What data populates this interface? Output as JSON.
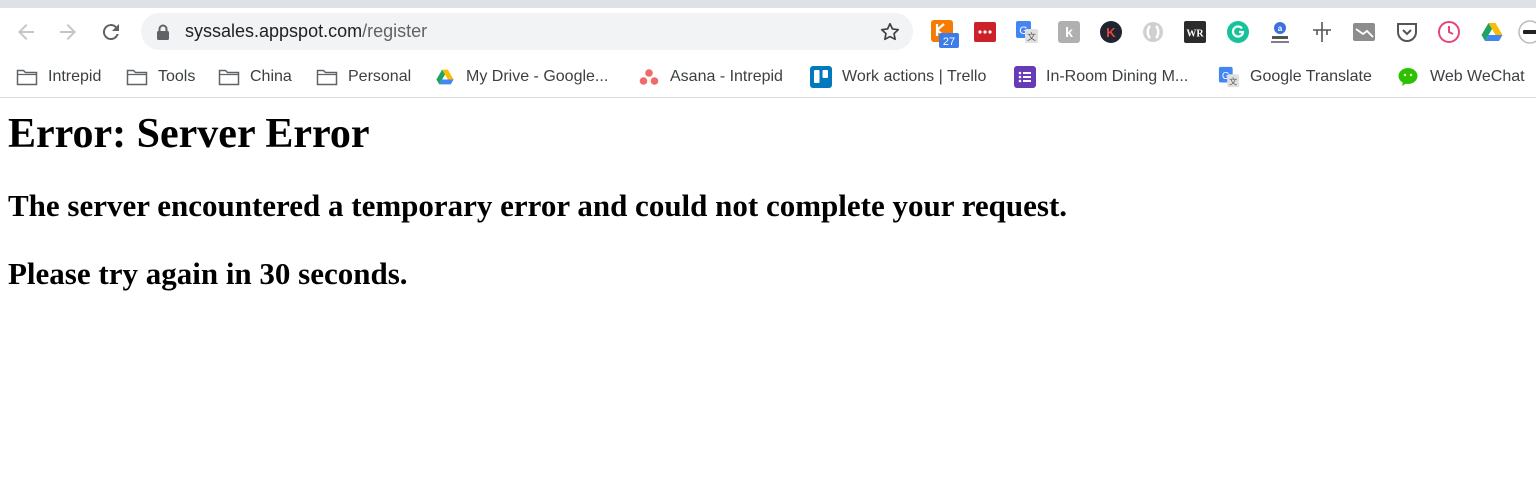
{
  "browser": {
    "url_host": "syssales.appspot.com",
    "url_path": "/register",
    "extensions": [
      {
        "name": "calendar-badge-extension-icon",
        "badge": "27"
      },
      {
        "name": "lastpass-extension-icon"
      },
      {
        "name": "google-translate-extension-icon"
      },
      {
        "name": "gray-k-extension-icon"
      },
      {
        "name": "k-dark-circle-extension-icon"
      },
      {
        "name": "s-gray-circle-extension-icon"
      },
      {
        "name": "wr-extension-icon"
      },
      {
        "name": "grammarly-extension-icon"
      },
      {
        "name": "stamp-extension-icon"
      },
      {
        "name": "crosshair-extension-icon"
      },
      {
        "name": "window-extension-icon"
      },
      {
        "name": "pocket-extension-icon"
      },
      {
        "name": "clock-extension-icon"
      },
      {
        "name": "google-drive-extension-icon"
      },
      {
        "name": "profile-avatar"
      }
    ]
  },
  "bookmarks": [
    {
      "label": "Intrepid",
      "icon": "folder-icon"
    },
    {
      "label": "Tools",
      "icon": "folder-icon"
    },
    {
      "label": "China",
      "icon": "folder-icon"
    },
    {
      "label": "Personal",
      "icon": "folder-icon"
    },
    {
      "label": "My Drive - Google...",
      "icon": "google-drive-icon"
    },
    {
      "label": "Asana - Intrepid",
      "icon": "asana-icon"
    },
    {
      "label": "Work actions | Trello",
      "icon": "trello-icon"
    },
    {
      "label": "In-Room Dining M...",
      "icon": "google-forms-icon"
    },
    {
      "label": "Google Translate",
      "icon": "google-translate-icon"
    },
    {
      "label": "Web WeChat",
      "icon": "wechat-icon"
    }
  ],
  "page": {
    "title": "Error: Server Error",
    "message": "The server encountered a temporary error and could not complete your request.",
    "retry": "Please try again in 30 seconds."
  },
  "colors": {
    "tab_strip": "#dee1e6",
    "omnibox_bg": "#f1f3f4",
    "icon_gray": "#5f6368"
  }
}
